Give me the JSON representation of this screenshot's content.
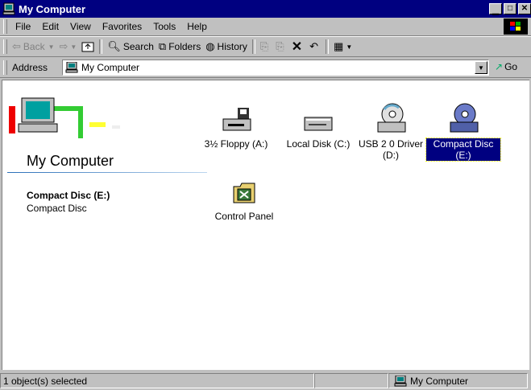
{
  "window": {
    "title": "My Computer"
  },
  "menu": [
    "File",
    "Edit",
    "View",
    "Favorites",
    "Tools",
    "Help"
  ],
  "toolbar": {
    "back": "Back",
    "search": "Search",
    "folders": "Folders",
    "history": "History"
  },
  "address": {
    "label": "Address",
    "value": "My Computer",
    "go": "Go"
  },
  "panel": {
    "folder_title": "My Computer",
    "selected_name": "Compact Disc (E:)",
    "selected_type": "Compact Disc"
  },
  "icons": [
    {
      "label": "3½ Floppy (A:)",
      "icon": "floppy-drive-icon"
    },
    {
      "label": "Local Disk (C:)",
      "icon": "hard-disk-icon"
    },
    {
      "label": "USB 2  0 Driver (D:)",
      "icon": "cd-drive-icon"
    },
    {
      "label": "Compact Disc (E:)",
      "icon": "cd-drive-icon",
      "selected": true
    },
    {
      "label": "Control Panel",
      "icon": "control-panel-icon"
    }
  ],
  "status": {
    "left": "1 object(s) selected",
    "zone": "My Computer"
  },
  "colors": {
    "titlebar": "#000080",
    "selection": "#000080",
    "chrome": "#c0c0c0"
  }
}
